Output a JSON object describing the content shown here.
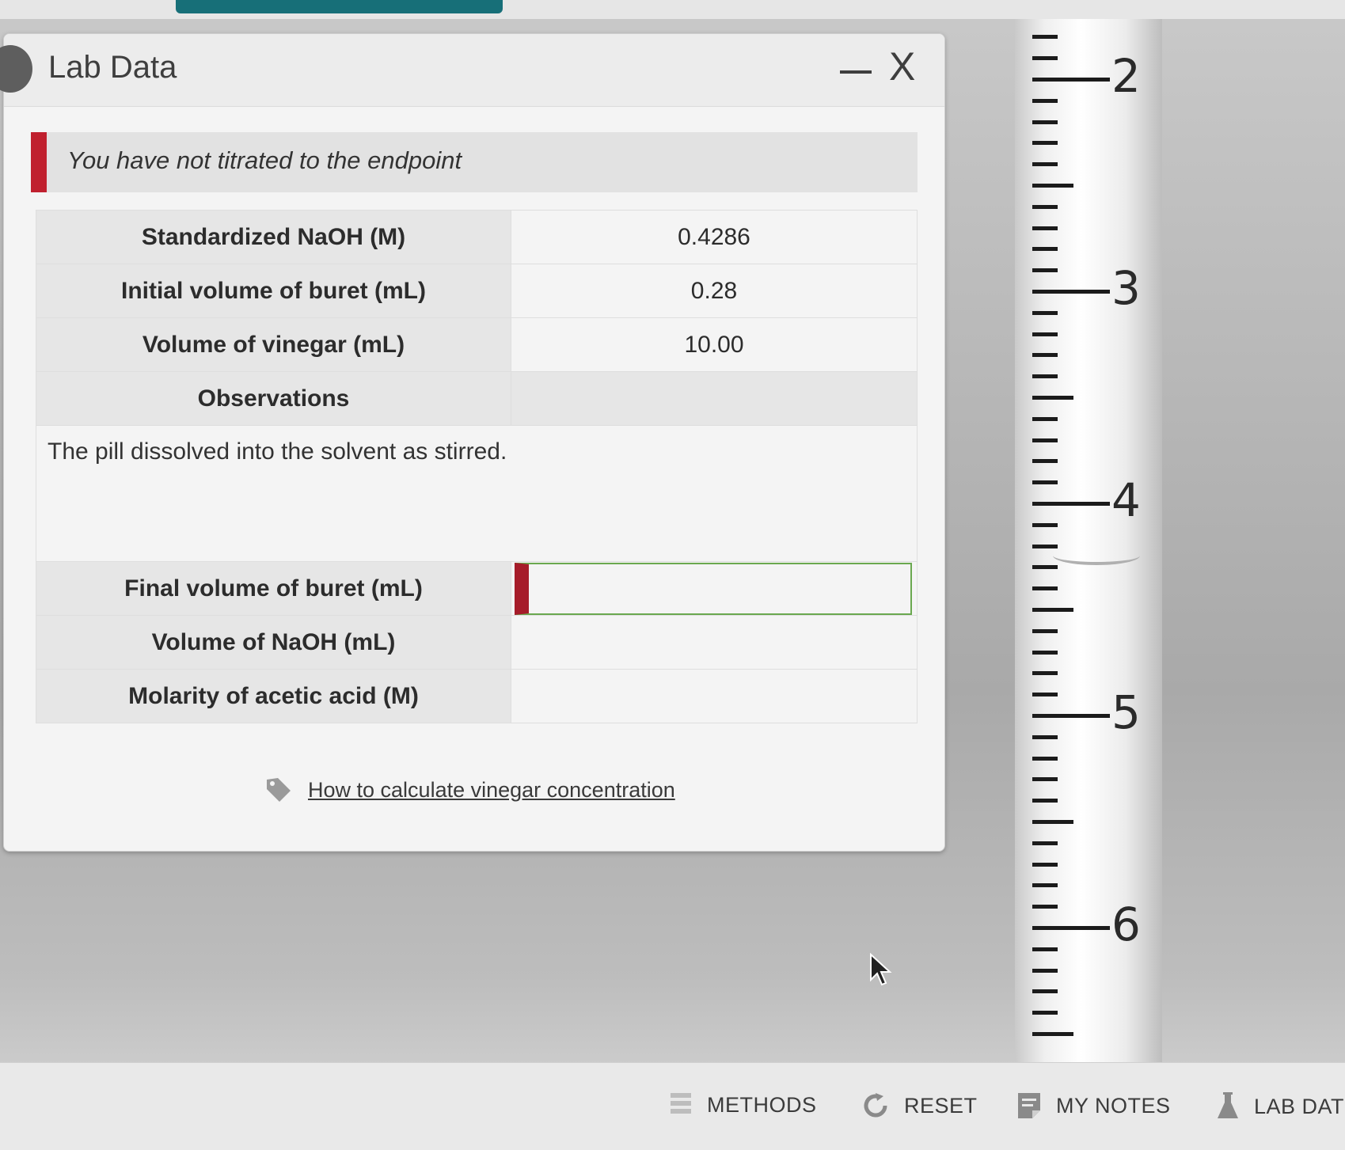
{
  "panel": {
    "title": "Lab Data",
    "minimize_label": "minimize",
    "close_label": "X"
  },
  "alert": {
    "message": "You have not titrated to the endpoint"
  },
  "table": {
    "rows": [
      {
        "label": "Standardized NaOH (M)",
        "value": "0.4286"
      },
      {
        "label": "Initial volume of buret (mL)",
        "value": "0.28"
      },
      {
        "label": "Volume of vinegar (mL)",
        "value": "10.00"
      },
      {
        "label": "Observations",
        "value": ""
      }
    ],
    "observation_text": "The pill dissolved into the solvent as stirred.",
    "final_volume_label": "Final volume of buret (mL)",
    "final_volume_value": "",
    "naoh_volume_label": "Volume of NaOH (mL)",
    "naoh_volume_value": "",
    "molarity_label": "Molarity of acetic acid (M)",
    "molarity_value": ""
  },
  "help_link": {
    "label": "How to calculate vinegar concentration"
  },
  "buret": {
    "scale_labels": [
      "2",
      "3",
      "4",
      "5",
      "6"
    ],
    "meniscus_reading_ml": 4.3
  },
  "toolbar": {
    "methods": "METHODS",
    "reset": "RESET",
    "my_notes": "MY NOTES",
    "lab_data": "LAB DAT"
  },
  "colors": {
    "accent_red": "#c0202e",
    "input_border_green": "#6aa84f",
    "top_tab_teal": "#176f78"
  }
}
